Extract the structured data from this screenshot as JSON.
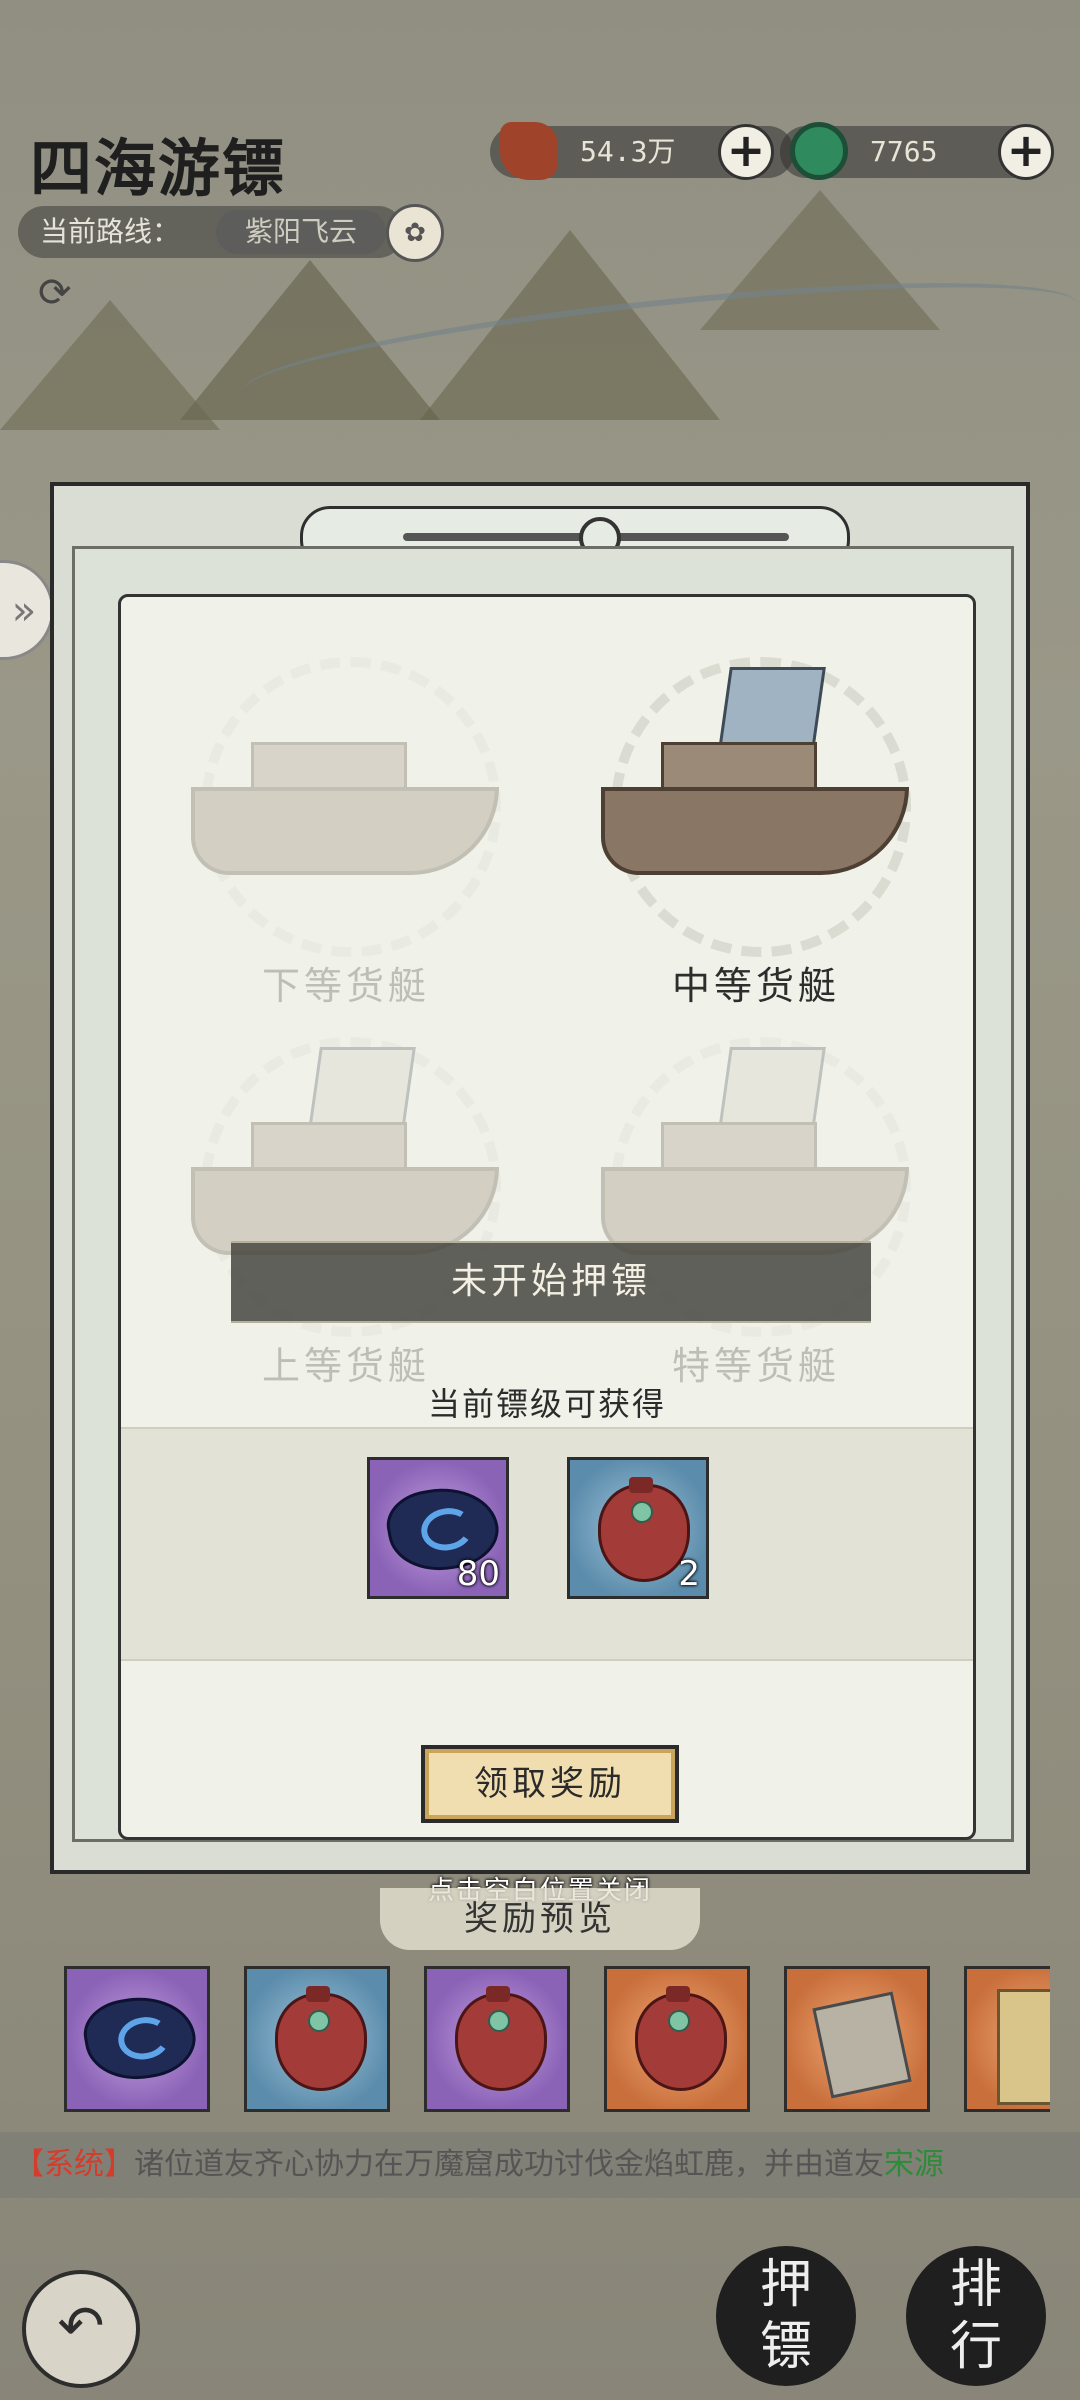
{
  "header": {
    "title": "四海游镖",
    "currency1": {
      "value": "54.3万",
      "icon": "copper-ore-icon",
      "color": "#a0432b"
    },
    "currency2": {
      "value": "7765",
      "icon": "jade-coin-icon",
      "color": "#2f8a5e"
    },
    "plus_label": "+"
  },
  "route": {
    "label": "当前路线：",
    "value": "紫阳飞云",
    "badge_icon": "lotus-badge-icon"
  },
  "modal": {
    "boats": [
      {
        "label": "下等货艇",
        "unlocked": false
      },
      {
        "label": "中等货艇",
        "unlocked": true
      },
      {
        "label": "上等货艇",
        "unlocked": false
      },
      {
        "label": "特等货艇",
        "unlocked": false
      }
    ],
    "status": "未开始押镖",
    "reward_caption": "当前镖级可获得",
    "rewards": [
      {
        "icon": "spirit-stone-icon",
        "count": "80",
        "bg": "purple"
      },
      {
        "icon": "red-pouch-icon",
        "count": "2",
        "bg": "blue"
      }
    ],
    "claim_label": "领取奖励"
  },
  "close_hint": "点击空白位置关闭",
  "preview": {
    "title": "奖励预览",
    "items": [
      {
        "icon": "spirit-stone-icon",
        "bg": "purple"
      },
      {
        "icon": "red-pouch-icon",
        "bg": "blue"
      },
      {
        "icon": "red-pouch-icon",
        "bg": "purple"
      },
      {
        "icon": "red-pouch-icon",
        "bg": "orange"
      },
      {
        "icon": "scroll-book-icon",
        "bg": "orange"
      },
      {
        "icon": "scroll-book-icon",
        "bg": "orange"
      }
    ]
  },
  "system": {
    "tag": "【系统】",
    "text": "诸位道友齐心协力在万魔窟成功讨伐金焰虹鹿，并由道友",
    "name": "宋源"
  },
  "bottom": {
    "escort_label_1": "押",
    "escort_label_2": "镖",
    "rank_label_1": "排",
    "rank_label_2": "行"
  }
}
